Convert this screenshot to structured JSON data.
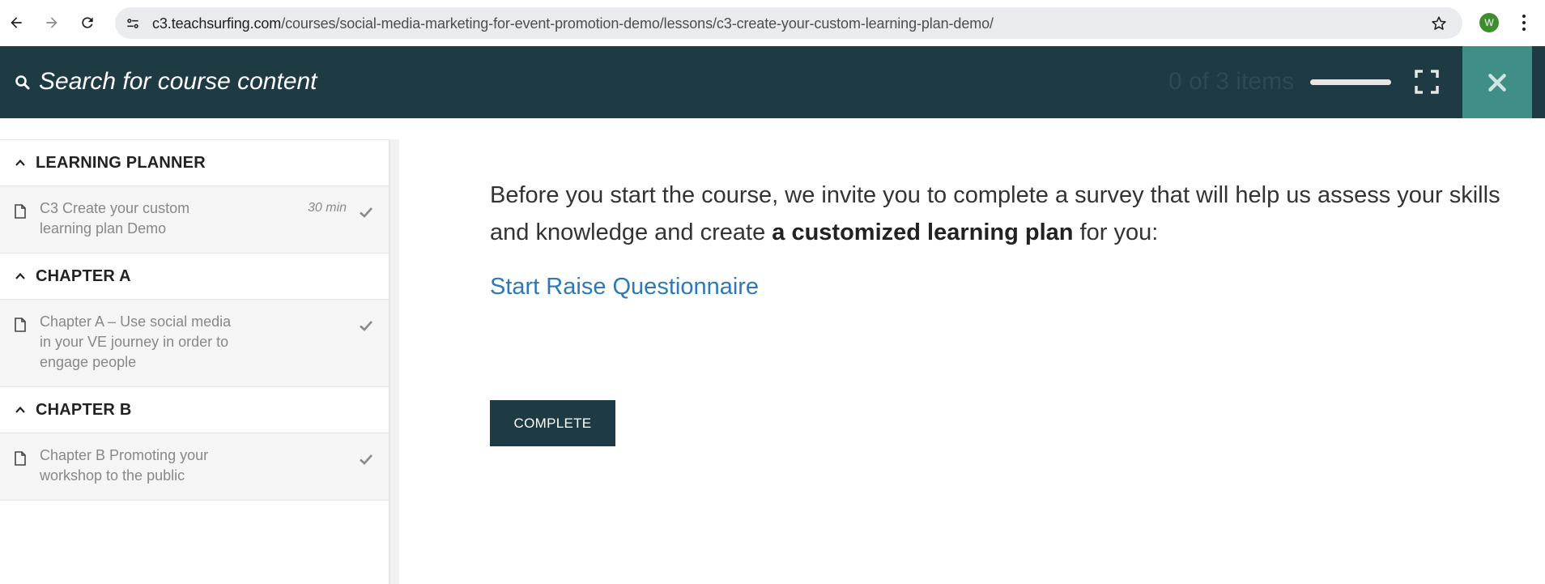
{
  "browser": {
    "url_domain": "c3.teachsurfing.com",
    "url_path": "/courses/social-media-marketing-for-event-promotion-demo/lessons/c3-create-your-custom-learning-plan-demo/",
    "profile_initial": "W"
  },
  "header": {
    "search_placeholder": "Search for course content",
    "progress_text": "0 of 3 items",
    "progress_fraction": 0
  },
  "sidebar": {
    "sections": [
      {
        "title": "LEARNING PLANNER",
        "lessons": [
          {
            "title": "C3 Create your custom\nlearning plan Demo",
            "duration": "30 min"
          }
        ]
      },
      {
        "title": "CHAPTER A",
        "lessons": [
          {
            "title": "Chapter A – Use social media\nin your VE journey in order to\nengage people"
          }
        ]
      },
      {
        "title": "CHAPTER B",
        "lessons": [
          {
            "title": "Chapter B Promoting your\nworkshop to the public"
          }
        ]
      }
    ]
  },
  "content": {
    "intro_before": "Before you start the course, we invite you to complete a survey that will help us assess your skills and knowledge and create ",
    "intro_bold": "a customized learning plan",
    "intro_after": " for you:",
    "questionnaire_link": "Start Raise Questionnaire",
    "complete_button": "COMPLETE"
  },
  "colors": {
    "header_bg": "#1e3a43",
    "close_bg": "#3f8f87",
    "link": "#2d79b6"
  }
}
